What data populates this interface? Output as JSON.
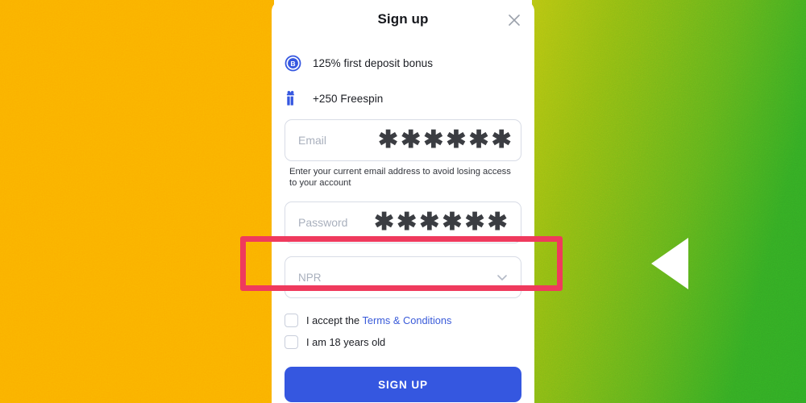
{
  "background": {
    "left_color": "#fab000",
    "right_gradient_from": "#b7c411",
    "right_gradient_to": "#2faa24",
    "back_arrow_name": "back-arrow"
  },
  "modal": {
    "title": "Sign up",
    "close_icon": "close-icon",
    "bonuses": [
      {
        "icon": "bonus-badge-icon",
        "text": "125% first deposit bonus"
      },
      {
        "icon": "gift-icon",
        "text": "+250 Freespin"
      }
    ],
    "email": {
      "placeholder": "Email",
      "masked_value": "✱✱✱✱✱✱",
      "helper": "Enter your current email address to avoid losing access to your account"
    },
    "password": {
      "placeholder": "Password",
      "masked_value": "✱✱✱✱✱✱"
    },
    "currency": {
      "value": "NPR",
      "chevron_icon": "chevron-down-icon"
    },
    "checkboxes": [
      {
        "prefix": "I accept the ",
        "link": "Terms & Conditions",
        "checked": false
      },
      {
        "prefix": "I am 18 years old",
        "link": "",
        "checked": false
      }
    ],
    "submit_label": "SIGN UP"
  },
  "annotation": {
    "highlight_color": "#ef3a5d",
    "target": "currency-select"
  }
}
